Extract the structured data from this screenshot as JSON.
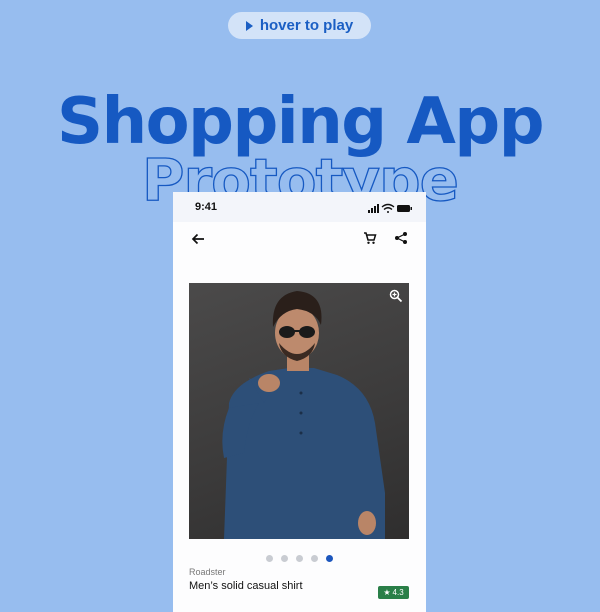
{
  "hover_button": {
    "label": "hover to play"
  },
  "hero": {
    "title": "Shopping App",
    "subtitle": "Prototype"
  },
  "colors": {
    "background": "#97bdef",
    "accent": "#1659c2",
    "rating_bg": "#2a7f48",
    "active_dot": "#1c56bd"
  },
  "phone": {
    "status_bar": {
      "time": "9:41",
      "icons": [
        "signal-icon",
        "wifi-icon",
        "battery-icon"
      ]
    },
    "app_bar": {
      "icons": [
        "back-arrow-icon",
        "cart-icon",
        "share-icon"
      ]
    },
    "product": {
      "image_icon": "zoom-in-icon",
      "carousel": {
        "count": 5,
        "active_index": 4
      },
      "brand": "Roadster",
      "name": "Men’s solid casual shirt",
      "rating": "4.3"
    }
  }
}
